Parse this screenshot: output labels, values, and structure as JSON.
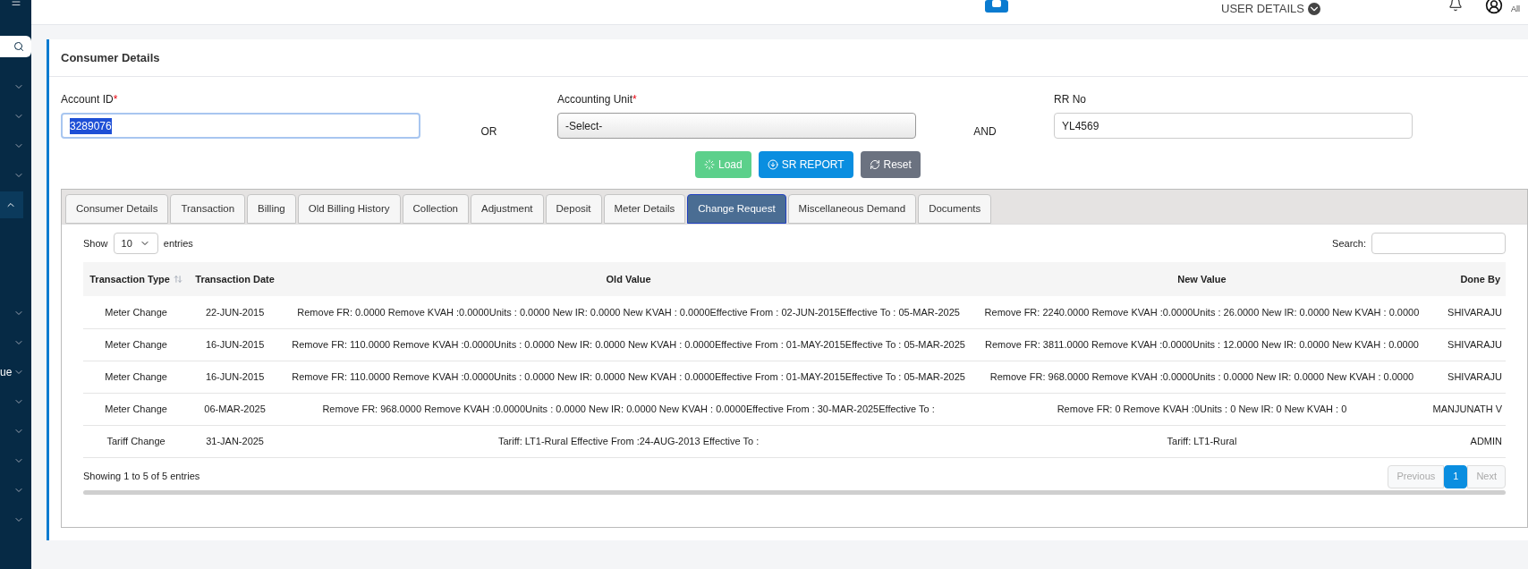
{
  "header": {
    "user_menu": "USER DETAILS",
    "role": "All"
  },
  "sidebar": {
    "items": [
      {
        "expanded": false
      },
      {
        "expanded": false
      },
      {
        "expanded": false
      },
      {
        "expanded": false
      },
      {
        "expanded": true
      },
      {
        "expanded": false
      },
      {
        "expanded": false
      },
      {
        "label": "ue",
        "expanded": false
      },
      {
        "expanded": false
      },
      {
        "expanded": false
      },
      {
        "expanded": false
      },
      {
        "expanded": false
      },
      {
        "expanded": false
      }
    ]
  },
  "card": {
    "title": "Consumer Details"
  },
  "form": {
    "required_mark": "*",
    "account_id": {
      "label": "Account ID",
      "required": true,
      "value": "3289076"
    },
    "or": "OR",
    "accounting_unit": {
      "label": "Accounting Unit",
      "required": true,
      "value": "-Select-"
    },
    "and": "AND",
    "rr_no": {
      "label": "RR No",
      "required": false,
      "value": "YL4569"
    },
    "buttons": [
      {
        "label": "Load",
        "kind": "load"
      },
      {
        "label": "SR REPORT",
        "kind": "report"
      },
      {
        "label": "Reset",
        "kind": "reset"
      }
    ]
  },
  "tabs": [
    {
      "label": "Consumer Details",
      "selected": false
    },
    {
      "label": "Transaction",
      "selected": false
    },
    {
      "label": "Billing",
      "selected": false
    },
    {
      "label": "Old Billing History",
      "selected": false
    },
    {
      "label": "Collection",
      "selected": false
    },
    {
      "label": "Adjustment",
      "selected": false
    },
    {
      "label": "Deposit",
      "selected": false
    },
    {
      "label": "Meter Details",
      "selected": false
    },
    {
      "label": "Change Request",
      "selected": true
    },
    {
      "label": "Miscellaneous Demand",
      "selected": false
    },
    {
      "label": "Documents",
      "selected": false
    }
  ],
  "table_controls": {
    "show": "Show",
    "page_size": "10",
    "entries": "entries",
    "search_label": "Search:"
  },
  "table": {
    "columns": [
      "Transaction Type",
      "Transaction Date",
      "Old Value",
      "New Value",
      "Done By"
    ],
    "rows": [
      [
        "Meter Change",
        "22-JUN-2015",
        "Remove FR: 0.0000 Remove KVAH :0.0000Units : 0.0000 New IR: 0.0000 New KVAH : 0.0000Effective From : 02-JUN-2015Effective To : 05-MAR-2025",
        "Remove FR: 2240.0000 Remove KVAH :0.0000Units : 26.0000 New IR: 0.0000 New KVAH : 0.0000",
        "SHIVARAJU"
      ],
      [
        "Meter Change",
        "16-JUN-2015",
        "Remove FR: 110.0000 Remove KVAH :0.0000Units : 0.0000 New IR: 0.0000 New KVAH : 0.0000Effective From : 01-MAY-2015Effective To : 05-MAR-2025",
        "Remove FR: 3811.0000 Remove KVAH :0.0000Units : 12.0000 New IR: 0.0000 New KVAH : 0.0000",
        "SHIVARAJU"
      ],
      [
        "Meter Change",
        "16-JUN-2015",
        "Remove FR: 110.0000 Remove KVAH :0.0000Units : 0.0000 New IR: 0.0000 New KVAH : 0.0000Effective From : 01-MAY-2015Effective To : 05-MAR-2025",
        "Remove FR: 968.0000 Remove KVAH :0.0000Units : 0.0000 New IR: 0.0000 New KVAH : 0.0000",
        "SHIVARAJU"
      ],
      [
        "Meter Change",
        "06-MAR-2025",
        "Remove FR: 968.0000 Remove KVAH :0.0000Units : 0.0000 New IR: 0.0000 New KVAH : 0.0000Effective From : 30-MAR-2025Effective To :",
        "Remove FR: 0 Remove KVAH :0Units : 0 New IR: 0 New KVAH : 0",
        "MANJUNATH V"
      ],
      [
        "Tariff Change",
        "31-JAN-2025",
        "Tariff: LT1-Rural Effective From :24-AUG-2013 Effective To :",
        "Tariff: LT1-Rural",
        "ADMIN"
      ]
    ]
  },
  "footer": {
    "info": "Showing 1 to 5 of 5 entries",
    "pagination": [
      {
        "label": "Previous",
        "kind": "prev",
        "disabled": true,
        "selected": false
      },
      {
        "label": "1",
        "kind": "page",
        "disabled": false,
        "selected": true
      },
      {
        "label": "Next",
        "kind": "next",
        "disabled": true,
        "selected": false
      }
    ]
  }
}
